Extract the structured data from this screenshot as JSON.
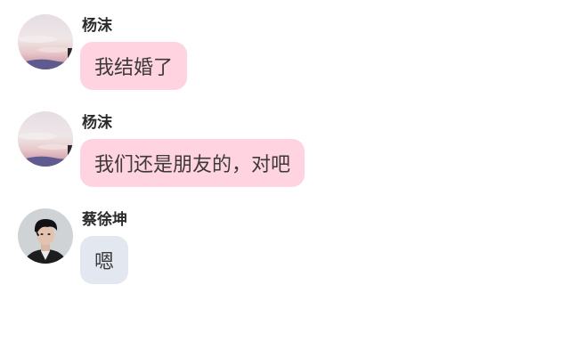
{
  "messages": [
    {
      "sender": "杨沫",
      "text": "我结婚了",
      "avatar": "sunset-sky-avatar",
      "bubble_color": "#ffd3df"
    },
    {
      "sender": "杨沫",
      "text": "我们还是朋友的，对吧",
      "avatar": "sunset-sky-avatar",
      "bubble_color": "#ffd3df"
    },
    {
      "sender": "蔡徐坤",
      "text": "嗯",
      "avatar": "portrait-photo-avatar",
      "bubble_color": "#e2e7f0"
    }
  ]
}
